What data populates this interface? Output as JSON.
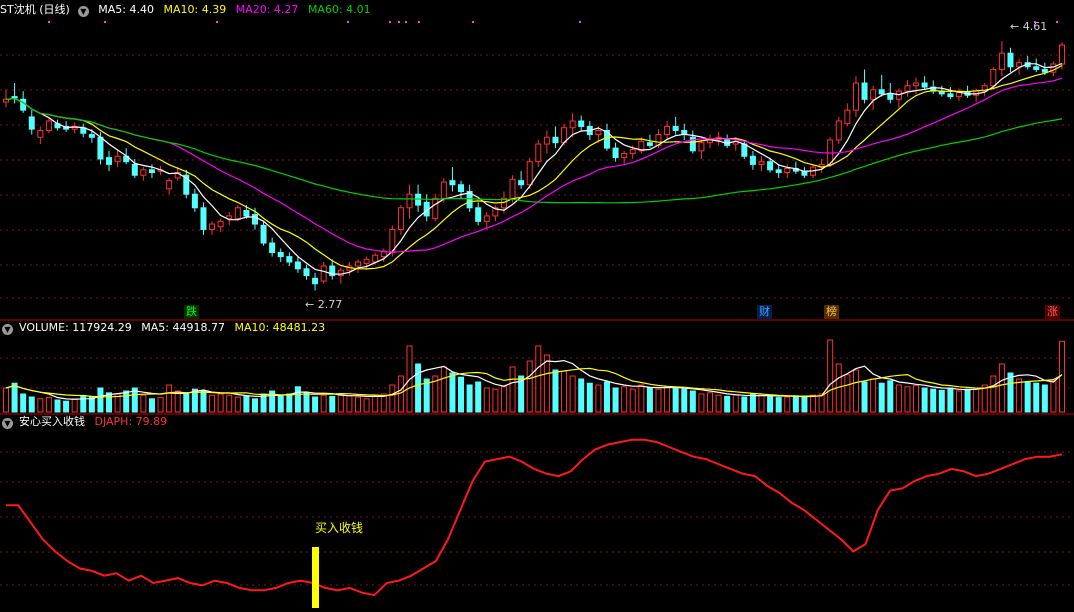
{
  "main_legend": {
    "title": "ST沈机 (日线)",
    "ma5": "MA5: 4.40",
    "ma10": "MA10: 4.39",
    "ma20": "MA20: 4.27",
    "ma60": "MA60: 4.01"
  },
  "volume_legend": {
    "volume": "VOLUME: 117924.29",
    "ma5": "MA5: 44918.77",
    "ma10": "MA10: 48481.23"
  },
  "indicator_legend": {
    "title": "安心买入收钱",
    "djaph": "DJAPH: 79.89"
  },
  "annotations": {
    "high": "4.61",
    "low": "2.77",
    "buy_signal": "买入收钱"
  },
  "event_tags": [
    "跌",
    "财",
    "榜",
    "涨"
  ],
  "colors": {
    "up": "#ff3030",
    "down": "#54ffff",
    "ma5": "#ffffff",
    "ma10": "#ffff00",
    "ma20": "#ff00ff",
    "ma60": "#00d000",
    "indicator": "#ff1a1a",
    "signal": "#ffff00",
    "grid": "#8a1010"
  },
  "chart_data": [
    {
      "type": "candlestick",
      "title": "ST沈机 (日线)",
      "period": "daily",
      "ylim": [
        2.7,
        4.75
      ],
      "candles": [
        [
          4.16,
          4.25,
          4.12,
          4.18
        ],
        [
          4.2,
          4.3,
          4.15,
          4.19
        ],
        [
          4.18,
          4.24,
          4.08,
          4.1
        ],
        [
          4.05,
          4.1,
          3.92,
          3.96
        ],
        [
          3.9,
          3.98,
          3.85,
          3.95
        ],
        [
          3.95,
          4.05,
          3.93,
          4.02
        ],
        [
          4.0,
          4.03,
          3.95,
          3.97
        ],
        [
          3.98,
          4.02,
          3.94,
          3.96
        ],
        [
          3.96,
          4.01,
          3.93,
          3.98
        ],
        [
          3.97,
          4.0,
          3.9,
          3.93
        ],
        [
          3.92,
          3.96,
          3.86,
          3.9
        ],
        [
          3.9,
          3.94,
          3.7,
          3.74
        ],
        [
          3.75,
          3.8,
          3.65,
          3.7
        ],
        [
          3.72,
          3.8,
          3.68,
          3.76
        ],
        [
          3.76,
          3.82,
          3.7,
          3.72
        ],
        [
          3.7,
          3.74,
          3.6,
          3.62
        ],
        [
          3.62,
          3.68,
          3.58,
          3.66
        ],
        [
          3.66,
          3.7,
          3.6,
          3.64
        ],
        [
          3.65,
          3.69,
          3.62,
          3.66
        ],
        [
          3.52,
          3.6,
          3.48,
          3.58
        ],
        [
          3.6,
          3.68,
          3.58,
          3.64
        ],
        [
          3.62,
          3.66,
          3.45,
          3.48
        ],
        [
          3.48,
          3.52,
          3.35,
          3.38
        ],
        [
          3.38,
          3.42,
          3.18,
          3.22
        ],
        [
          3.22,
          3.28,
          3.18,
          3.26
        ],
        [
          3.24,
          3.3,
          3.2,
          3.28
        ],
        [
          3.3,
          3.35,
          3.25,
          3.32
        ],
        [
          3.3,
          3.4,
          3.28,
          3.38
        ],
        [
          3.36,
          3.4,
          3.3,
          3.32
        ],
        [
          3.33,
          3.38,
          3.22,
          3.26
        ],
        [
          3.25,
          3.28,
          3.1,
          3.12
        ],
        [
          3.12,
          3.16,
          3.02,
          3.05
        ],
        [
          3.05,
          3.08,
          2.98,
          3.02
        ],
        [
          3.02,
          3.05,
          2.95,
          2.98
        ],
        [
          2.98,
          3.02,
          2.9,
          2.93
        ],
        [
          2.93,
          2.96,
          2.85,
          2.88
        ],
        [
          2.86,
          2.9,
          2.77,
          2.82
        ],
        [
          2.84,
          2.98,
          2.82,
          2.95
        ],
        [
          2.95,
          3.0,
          2.85,
          2.88
        ],
        [
          2.88,
          2.94,
          2.82,
          2.92
        ],
        [
          2.92,
          2.98,
          2.88,
          2.95
        ],
        [
          2.95,
          3.0,
          2.9,
          2.98
        ],
        [
          2.97,
          3.02,
          2.92,
          3.0
        ],
        [
          2.98,
          3.05,
          2.96,
          3.03
        ],
        [
          3.02,
          3.08,
          2.98,
          3.06
        ],
        [
          3.05,
          3.25,
          3.02,
          3.22
        ],
        [
          3.22,
          3.4,
          3.18,
          3.38
        ],
        [
          3.38,
          3.55,
          3.3,
          3.48
        ],
        [
          3.48,
          3.55,
          3.35,
          3.4
        ],
        [
          3.42,
          3.48,
          3.28,
          3.32
        ],
        [
          3.3,
          3.48,
          3.28,
          3.45
        ],
        [
          3.45,
          3.6,
          3.42,
          3.57
        ],
        [
          3.58,
          3.68,
          3.5,
          3.55
        ],
        [
          3.55,
          3.58,
          3.45,
          3.5
        ],
        [
          3.5,
          3.55,
          3.35,
          3.38
        ],
        [
          3.38,
          3.42,
          3.25,
          3.28
        ],
        [
          3.28,
          3.35,
          3.22,
          3.32
        ],
        [
          3.32,
          3.4,
          3.28,
          3.38
        ],
        [
          3.38,
          3.5,
          3.34,
          3.45
        ],
        [
          3.45,
          3.62,
          3.42,
          3.59
        ],
        [
          3.58,
          3.65,
          3.52,
          3.55
        ],
        [
          3.55,
          3.75,
          3.52,
          3.72
        ],
        [
          3.72,
          3.88,
          3.68,
          3.85
        ],
        [
          3.85,
          3.95,
          3.78,
          3.9
        ],
        [
          3.9,
          3.98,
          3.82,
          3.86
        ],
        [
          3.86,
          4.0,
          3.84,
          3.97
        ],
        [
          3.97,
          4.08,
          3.9,
          4.02
        ],
        [
          4.02,
          4.06,
          3.95,
          3.98
        ],
        [
          3.98,
          4.02,
          3.88,
          3.92
        ],
        [
          3.92,
          3.98,
          3.86,
          3.95
        ],
        [
          3.95,
          4.0,
          3.8,
          3.82
        ],
        [
          3.82,
          3.86,
          3.72,
          3.75
        ],
        [
          3.75,
          3.8,
          3.7,
          3.78
        ],
        [
          3.78,
          3.84,
          3.74,
          3.81
        ],
        [
          3.8,
          3.9,
          3.78,
          3.87
        ],
        [
          3.86,
          3.92,
          3.82,
          3.84
        ],
        [
          3.84,
          3.96,
          3.82,
          3.92
        ],
        [
          3.92,
          4.02,
          3.88,
          3.98
        ],
        [
          3.98,
          4.05,
          3.92,
          3.95
        ],
        [
          3.95,
          4.0,
          3.88,
          3.92
        ],
        [
          3.9,
          3.95,
          3.78,
          3.8
        ],
        [
          3.8,
          3.88,
          3.74,
          3.86
        ],
        [
          3.86,
          3.92,
          3.82,
          3.88
        ],
        [
          3.88,
          3.94,
          3.84,
          3.9
        ],
        [
          3.88,
          3.92,
          3.82,
          3.84
        ],
        [
          3.85,
          3.9,
          3.8,
          3.87
        ],
        [
          3.85,
          3.88,
          3.74,
          3.76
        ],
        [
          3.76,
          3.8,
          3.66,
          3.7
        ],
        [
          3.7,
          3.76,
          3.65,
          3.72
        ],
        [
          3.72,
          3.75,
          3.64,
          3.66
        ],
        [
          3.66,
          3.7,
          3.6,
          3.64
        ],
        [
          3.64,
          3.7,
          3.6,
          3.67
        ],
        [
          3.67,
          3.72,
          3.63,
          3.65
        ],
        [
          3.65,
          3.68,
          3.6,
          3.62
        ],
        [
          3.62,
          3.7,
          3.6,
          3.68
        ],
        [
          3.68,
          3.74,
          3.64,
          3.7
        ],
        [
          3.7,
          3.9,
          3.68,
          3.88
        ],
        [
          3.88,
          4.05,
          3.85,
          4.02
        ],
        [
          4.0,
          4.15,
          3.98,
          4.1
        ],
        [
          4.1,
          4.35,
          4.05,
          4.3
        ],
        [
          4.3,
          4.4,
          4.15,
          4.18
        ],
        [
          4.18,
          4.28,
          4.1,
          4.25
        ],
        [
          4.25,
          4.36,
          4.2,
          4.22
        ],
        [
          4.22,
          4.3,
          4.15,
          4.18
        ],
        [
          4.18,
          4.26,
          4.12,
          4.24
        ],
        [
          4.24,
          4.32,
          4.2,
          4.28
        ],
        [
          4.28,
          4.34,
          4.22,
          4.3
        ],
        [
          4.3,
          4.35,
          4.25,
          4.27
        ],
        [
          4.27,
          4.32,
          4.22,
          4.24
        ],
        [
          4.24,
          4.28,
          4.2,
          4.22
        ],
        [
          4.22,
          4.27,
          4.18,
          4.2
        ],
        [
          4.2,
          4.26,
          4.17,
          4.23
        ],
        [
          4.23,
          4.28,
          4.19,
          4.21
        ],
        [
          4.21,
          4.26,
          4.16,
          4.24
        ],
        [
          4.24,
          4.3,
          4.2,
          4.28
        ],
        [
          4.28,
          4.42,
          4.25,
          4.4
        ],
        [
          4.4,
          4.61,
          4.35,
          4.52
        ],
        [
          4.52,
          4.56,
          4.38,
          4.42
        ],
        [
          4.42,
          4.48,
          4.36,
          4.45
        ],
        [
          4.45,
          4.5,
          4.4,
          4.42
        ],
        [
          4.42,
          4.48,
          4.38,
          4.4
        ],
        [
          4.4,
          4.45,
          4.36,
          4.38
        ],
        [
          4.38,
          4.46,
          4.35,
          4.44
        ],
        [
          4.44,
          4.6,
          4.4,
          4.58
        ]
      ],
      "ma5_approx": true
    },
    {
      "type": "bar",
      "title": "VOLUME",
      "values": [
        40,
        48,
        30,
        25,
        22,
        24,
        20,
        18,
        22,
        26,
        25,
        40,
        32,
        30,
        35,
        40,
        28,
        22,
        24,
        45,
        35,
        30,
        38,
        35,
        28,
        30,
        28,
        25,
        26,
        22,
        30,
        35,
        28,
        30,
        42,
        32,
        25,
        28,
        26,
        30,
        27,
        25,
        22,
        26,
        30,
        45,
        60,
        110,
        80,
        55,
        60,
        75,
        65,
        58,
        45,
        50,
        40,
        38,
        42,
        75,
        60,
        85,
        110,
        95,
        70,
        68,
        60,
        55,
        48,
        45,
        50,
        40,
        42,
        38,
        45,
        40,
        38,
        42,
        40,
        38,
        35,
        30,
        32,
        28,
        26,
        28,
        25,
        30,
        28,
        26,
        24,
        25,
        27,
        26,
        28,
        30,
        120,
        80,
        62,
        70,
        50,
        55,
        48,
        52,
        45,
        42,
        44,
        40,
        38,
        36,
        40,
        35,
        38,
        40,
        45,
        60,
        80,
        65,
        55,
        50,
        48,
        45,
        52,
        117.9
      ]
    },
    {
      "type": "line",
      "title": "安心买入收钱",
      "series": [
        {
          "name": "DJAPH",
          "values": [
            59,
            59,
            52,
            45,
            40,
            36,
            33,
            32,
            30,
            31,
            28,
            30,
            27,
            28,
            29,
            27,
            26,
            28,
            27,
            25,
            24,
            24,
            25,
            27,
            28,
            27,
            25,
            24,
            25,
            23,
            22,
            27,
            28,
            30,
            33,
            36,
            45,
            57,
            69,
            77,
            78,
            79,
            77,
            74,
            72,
            71,
            73,
            78,
            82,
            84,
            85,
            86,
            86,
            85,
            83,
            81,
            79,
            78,
            76,
            74,
            72,
            71,
            67,
            64,
            60,
            57,
            53,
            49,
            45,
            40,
            43,
            57,
            65,
            66,
            69,
            71,
            72,
            74,
            73,
            71,
            72,
            74,
            76,
            78,
            79,
            79,
            80
          ]
        }
      ],
      "ylim": [
        20,
        90
      ]
    }
  ]
}
